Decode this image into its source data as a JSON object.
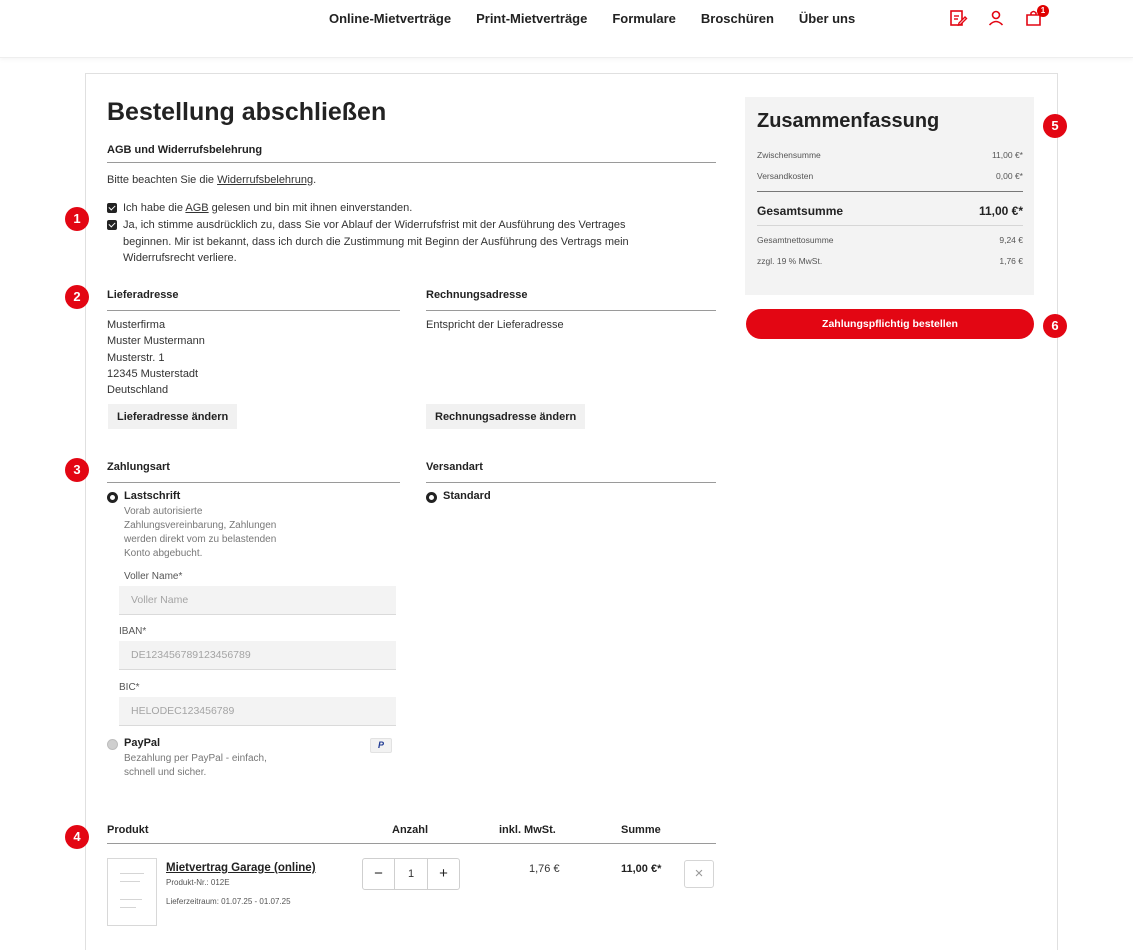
{
  "nav": {
    "links": [
      "Online-Mietverträge",
      "Print-Mietverträge",
      "Formulare",
      "Broschüren",
      "Über uns"
    ],
    "icons": [
      "edit-document-icon",
      "user-icon",
      "cart-icon"
    ],
    "cart_count": "1"
  },
  "checkout": {
    "title": "Bestellung abschließen",
    "terms": {
      "heading": "AGB und Widerrufsbelehrung",
      "notice_prefix": "Bitte beachten Sie die ",
      "notice_link": "Widerrufsbelehrung",
      "notice_suffix": ".",
      "agb_prefix": "Ich habe die ",
      "agb_link": "AGB",
      "agb_suffix": " gelesen und bin mit ihnen einverstanden.",
      "withdrawal_lines": [
        "Ja, ich stimme ausdrücklich zu, dass Sie vor Ablauf der Widerrufsfrist mit der Ausführung des Vertrages",
        "beginnen. Mir ist bekannt, dass ich durch die Zustimmung mit Beginn der Ausführung des Vertrags mein",
        "Widerrufsrecht verliere."
      ]
    },
    "shipping_address": {
      "heading": "Lieferadresse",
      "lines": [
        "Musterfirma",
        "Muster Mustermann",
        "Musterstr. 1",
        "12345 Musterstadt",
        "Deutschland"
      ],
      "button": "Lieferadresse ändern"
    },
    "billing_address": {
      "heading": "Rechnungsadresse",
      "text": "Entspricht der Lieferadresse",
      "button": "Rechnungsadresse ändern"
    },
    "payment": {
      "heading": "Zahlungsart",
      "debit": {
        "label": "Lastschrift",
        "description": [
          "Vorab autorisierte",
          "Zahlungsvereinbarung, Zahlungen",
          "werden direkt vom zu belastenden",
          "Konto abgebucht."
        ],
        "name_label": "Voller Name*",
        "name_placeholder": "Voller Name",
        "iban_label": "IBAN*",
        "iban_placeholder": "DE123456789123456789",
        "bic_label": "BIC*",
        "bic_placeholder": "HELODEC123456789"
      },
      "paypal": {
        "label": "PayPal",
        "badge": "P",
        "description": [
          "Bezahlung per PayPal - einfach,",
          "schnell und sicher."
        ]
      }
    },
    "shipping_method": {
      "heading": "Versandart",
      "option": "Standard"
    },
    "products": {
      "columns": [
        "Produkt",
        "Anzahl",
        "inkl. MwSt.",
        "Summe"
      ],
      "items": [
        {
          "name": "Mietvertrag Garage (online)",
          "number": "Produkt-Nr.: 012E",
          "delivery": "Lieferzeitraum: 01.07.25 - 01.07.25",
          "quantity": "1",
          "vat": "1,76 €",
          "total": "11,00 €*"
        }
      ]
    }
  },
  "summary": {
    "title": "Zusammenfassung",
    "subtotal_label": "Zwischensumme",
    "subtotal_value": "11,00 €*",
    "shipping_label": "Versandkosten",
    "shipping_value": "0,00 €*",
    "total_label": "Gesamtsumme",
    "total_value": "11,00 €*",
    "net_label": "Gesamtnettosumme",
    "net_value": "9,24 €",
    "tax_label": "zzgl. 19 % MwSt.",
    "tax_value": "1,76 €",
    "order_button": "Zahlungspflichtig bestellen"
  },
  "markers": [
    "1",
    "2",
    "3",
    "4",
    "5",
    "6"
  ],
  "colors": {
    "accent": "#e30613",
    "summary_bg": "#f3f3f3"
  }
}
